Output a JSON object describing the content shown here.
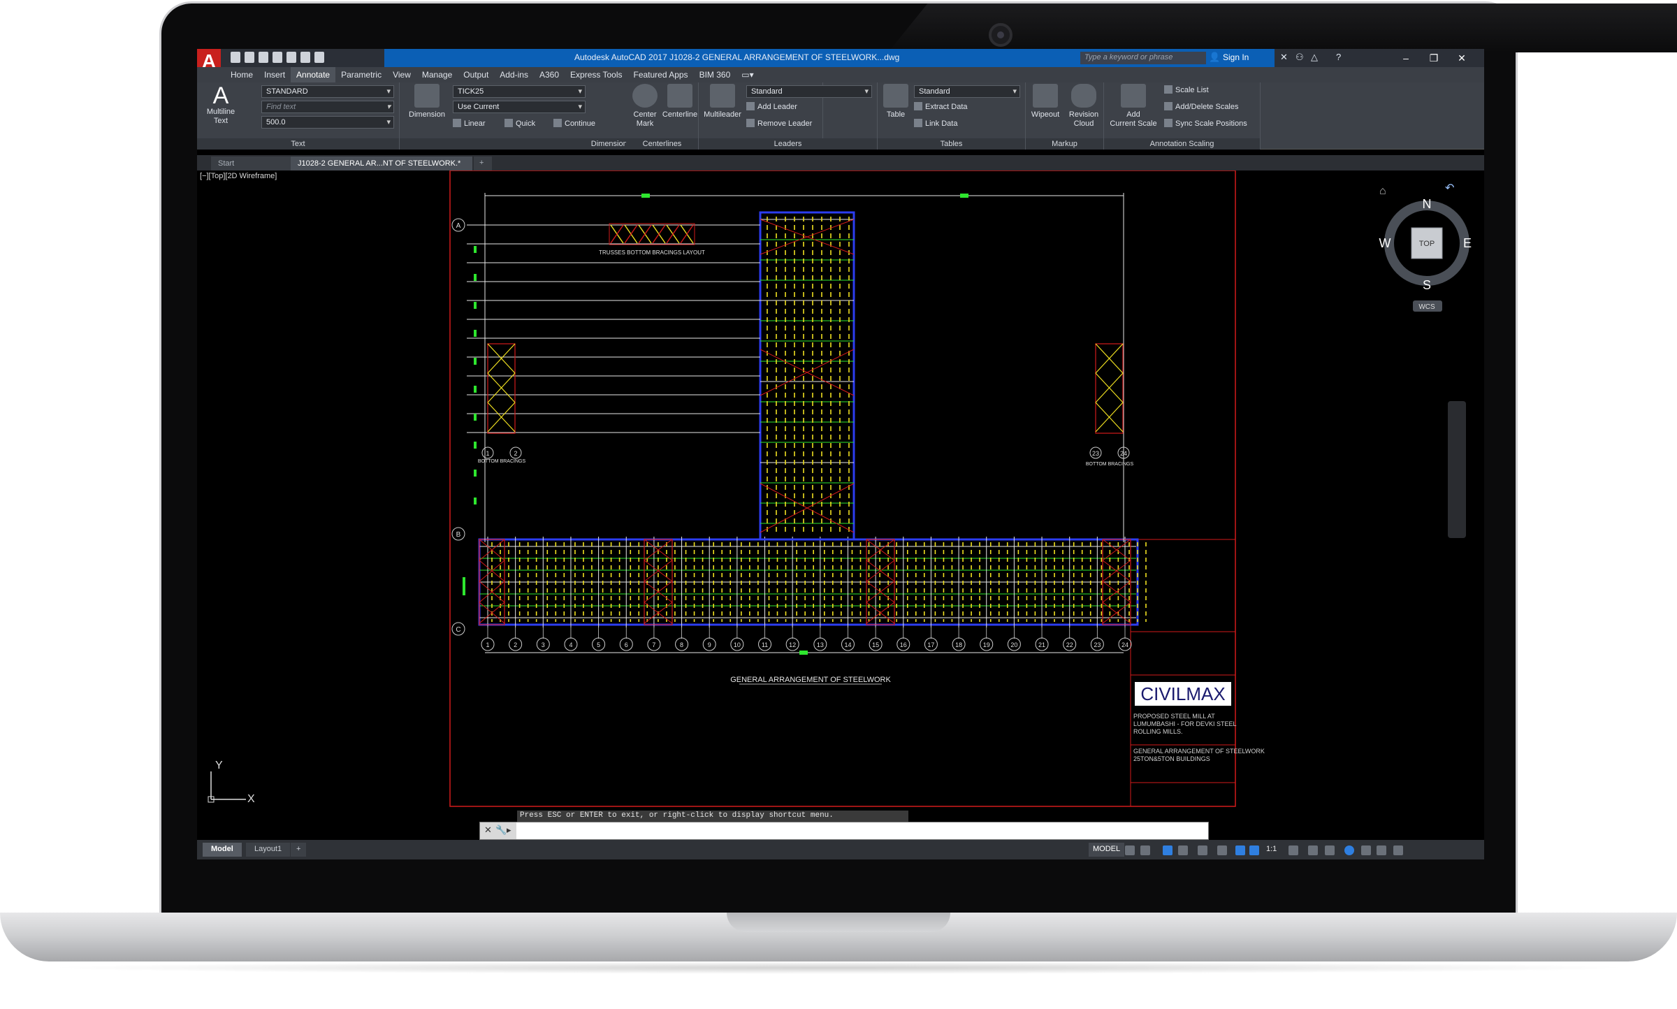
{
  "window": {
    "title": "Autodesk AutoCAD 2017   J1028-2 GENERAL ARRANGEMENT OF STEELWORK...dwg",
    "search_placeholder": "Type a keyword or phrase",
    "signin": "Sign In"
  },
  "app_menu_letter": "A",
  "menu_tabs": [
    "Home",
    "Insert",
    "Annotate",
    "Parametric",
    "View",
    "Manage",
    "Output",
    "Add-ins",
    "A360",
    "Express Tools",
    "Featured Apps",
    "BIM 360"
  ],
  "active_menu_tab": "Annotate",
  "ribbon": {
    "text": {
      "title": "Text",
      "multiline_text": "Multiline\nText",
      "style_value": "STANDARD",
      "find_placeholder": "Find text",
      "height_value": "500.0"
    },
    "dimensions": {
      "title": "Dimensions",
      "dimension": "Dimension",
      "style_value": "TICK25",
      "layer_value": "Use Current",
      "linear": "Linear",
      "quick": "Quick",
      "continue": "Continue"
    },
    "centerlines": {
      "title": "Centerlines",
      "center_mark": "Center\nMark",
      "centerline": "Centerline"
    },
    "leaders": {
      "title": "Leaders",
      "multileader": "Multileader",
      "style_value": "Standard",
      "add_leader": "Add Leader",
      "remove_leader": "Remove Leader"
    },
    "tables": {
      "title": "Tables",
      "table": "Table",
      "style_value": "Standard",
      "extract_data": "Extract Data",
      "link_data": "Link Data"
    },
    "markup": {
      "title": "Markup",
      "wipeout": "Wipeout",
      "revision_cloud": "Revision\nCloud"
    },
    "annotation_scaling": {
      "title": "Annotation Scaling",
      "add_current_scale": "Add\nCurrent Scale",
      "scale_list": "Scale List",
      "add_delete_scales": "Add/Delete Scales",
      "sync_scale_positions": "Sync Scale Positions"
    }
  },
  "doc_tabs": {
    "start": "Start",
    "active": "J1028-2 GENERAL AR...NT OF STEELWORK.*",
    "new": "+"
  },
  "viewport": {
    "label": "[−][Top][2D Wireframe]",
    "viewcube": {
      "n": "N",
      "s": "S",
      "e": "E",
      "w": "W",
      "face": "TOP",
      "ucs": "WCS"
    },
    "ucs_x": "X",
    "ucs_y": "Y"
  },
  "drawing": {
    "main_title": "GENERAL ARRANGEMENT OF STEELWORK",
    "trusses_label": "TRUSSES BOTTOM BRACINGS LAYOUT",
    "bottom_bracings_left": "BOTTOM BRACINGS",
    "bottom_bracings_right": "BOTTOM BRACINGS",
    "grid_rows": [
      "A",
      "B",
      "C"
    ],
    "grid_cols": [
      "1",
      "2",
      "3",
      "4",
      "5",
      "6",
      "7",
      "8",
      "9",
      "10",
      "11",
      "12",
      "13",
      "14",
      "15",
      "16",
      "17",
      "18",
      "19",
      "20",
      "21",
      "22",
      "23",
      "24"
    ],
    "left_bay_cols": [
      "1",
      "2"
    ],
    "right_bay_cols": [
      "23",
      "24"
    ],
    "titleblock": {
      "brand": "CIVILMAX",
      "project": "PROPOSED STEEL MILL AT LUMUMBASHI - FOR DEVKI STEEL ROLLING MILLS.",
      "drawing": "GENERAL ARRANGEMENT OF STEELWORK 25TON&5TON BUILDINGS"
    }
  },
  "command": {
    "hint": "Press ESC or ENTER to exit, or right-click to display shortcut menu."
  },
  "status": {
    "model_tab": "Model",
    "layout_tab": "Layout1",
    "add_tab": "+",
    "model_indicator": "MODEL",
    "scale": "1:1"
  },
  "colors": {
    "frame_red": "#d21a1a",
    "member_green": "#2ee62e",
    "member_yellow": "#f0e020",
    "member_blue": "#2c3df0",
    "member_white": "#e8e8e8"
  }
}
